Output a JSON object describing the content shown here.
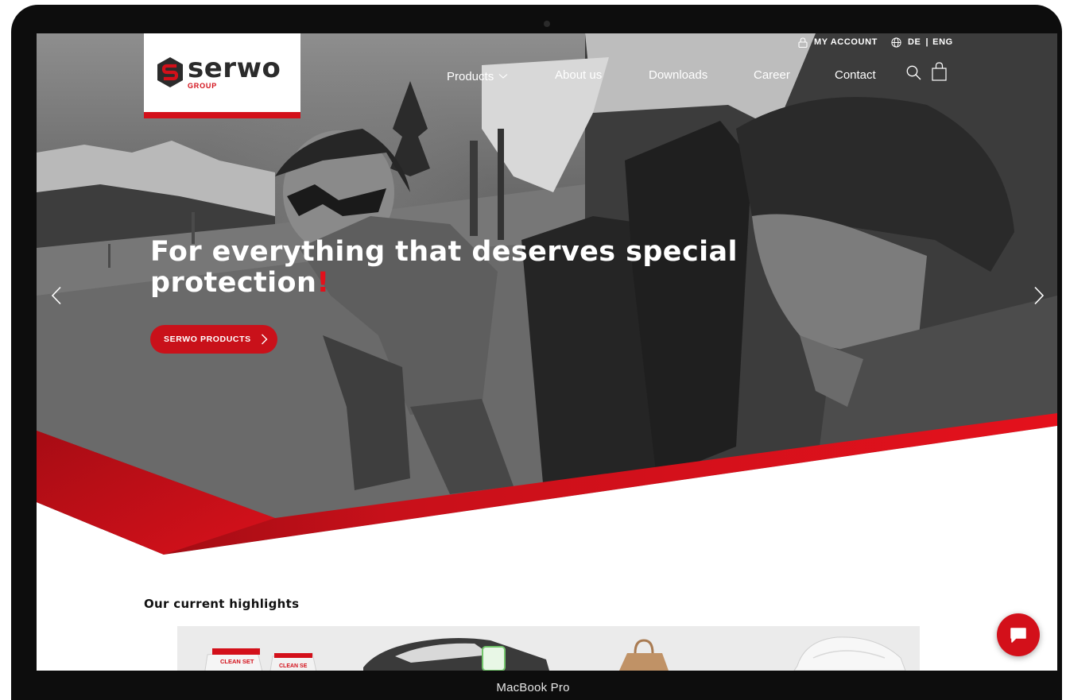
{
  "device": {
    "label": "MacBook Pro"
  },
  "brand": {
    "name": "serwo",
    "sub": "GROUP",
    "accent": "#d3101a"
  },
  "utility": {
    "account": "MY ACCOUNT",
    "lang_de": "DE",
    "lang_sep": "|",
    "lang_en": "ENG"
  },
  "nav": {
    "products": "Products",
    "about": "About us",
    "downloads": "Downloads",
    "career": "Career",
    "contact": "Contact"
  },
  "hero": {
    "title": "For everything that deserves special protection",
    "title_mark": "!",
    "cta": "SERWO PRODUCTS"
  },
  "highlights": {
    "title": "Our current highlights",
    "box_label_1": "CLEAN SET",
    "box_label_2": "CLEAN SE"
  },
  "icons": {
    "account": "lock-icon",
    "language": "globe-icon",
    "search": "search-icon",
    "cart": "shopping-bag-icon",
    "chat": "chat-icon",
    "prev": "chevron-left-icon",
    "next": "chevron-right-icon"
  }
}
